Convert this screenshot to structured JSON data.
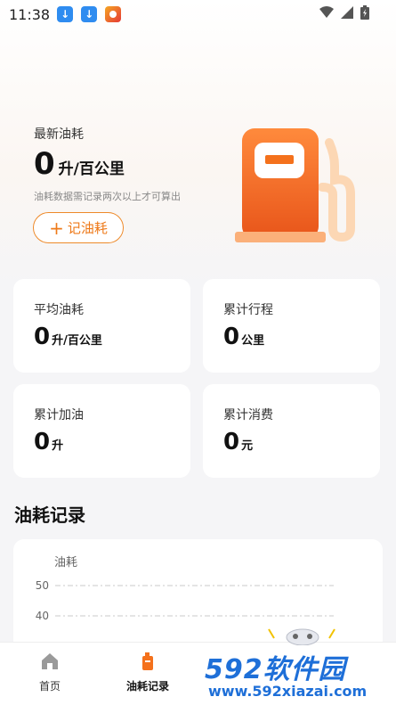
{
  "status_bar": {
    "time": "11:38"
  },
  "hero": {
    "label": "最新油耗",
    "value": "0",
    "unit": "升/百公里",
    "hint": "油耗数据需记录两次以上才可算出",
    "add_button": "记油耗",
    "add_icon": "+"
  },
  "stats": [
    {
      "label": "平均油耗",
      "value": "0",
      "unit": "升/百公里"
    },
    {
      "label": "累计行程",
      "value": "0",
      "unit": "公里"
    },
    {
      "label": "累计加油",
      "value": "0",
      "unit": "升"
    },
    {
      "label": "累计消费",
      "value": "0",
      "unit": "元"
    }
  ],
  "records": {
    "title": "油耗记录"
  },
  "chart_data": {
    "type": "line",
    "title": "",
    "ylabel": "油耗",
    "yticks": [
      50,
      40
    ],
    "ylim": [
      0,
      50
    ],
    "series": [],
    "grid": true
  },
  "nav": {
    "items": [
      {
        "label": "首页",
        "icon": "home-icon",
        "active": false
      },
      {
        "label": "油耗记录",
        "icon": "fuel-can-icon",
        "active": true
      }
    ]
  },
  "watermark": {
    "brand": "592软件园",
    "url": "www.592xiazai.com"
  },
  "colors": {
    "accent": "#ee7a1a",
    "pump": "#f4711c",
    "brand_blue": "#1e6fd8"
  }
}
